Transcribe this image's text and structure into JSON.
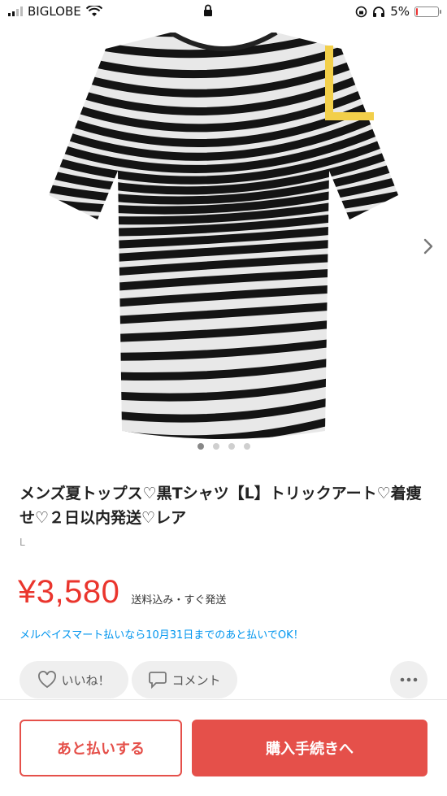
{
  "status_bar": {
    "carrier": "BIGLOBE",
    "battery": "5%",
    "signal_bars_filled": 2
  },
  "product": {
    "image_icon": "tshirt-photo",
    "size_mark": "L",
    "photo_count": 4,
    "current_photo": 1,
    "title": "メンズ夏トップス♡黒Tシャツ【L】トリックアート♡着痩せ♡２日以内発送♡レア",
    "size": "L",
    "price": "¥3,580",
    "price_note": "送料込み・すぐ発送",
    "merpay_note": "メルペイスマート払いなら10月31日までのあと払いでOK！"
  },
  "actions": {
    "like_label": "いいね！",
    "comment_label": "コメント",
    "more_icon": "more-dots-icon"
  },
  "footer": {
    "pay_later_label": "あと払いする",
    "buy_label": "購入手続きへ"
  },
  "colors": {
    "price": "#ea352d",
    "accent": "#e5504a",
    "link": "#0095ee",
    "size_mark": "#f2cf4a"
  }
}
